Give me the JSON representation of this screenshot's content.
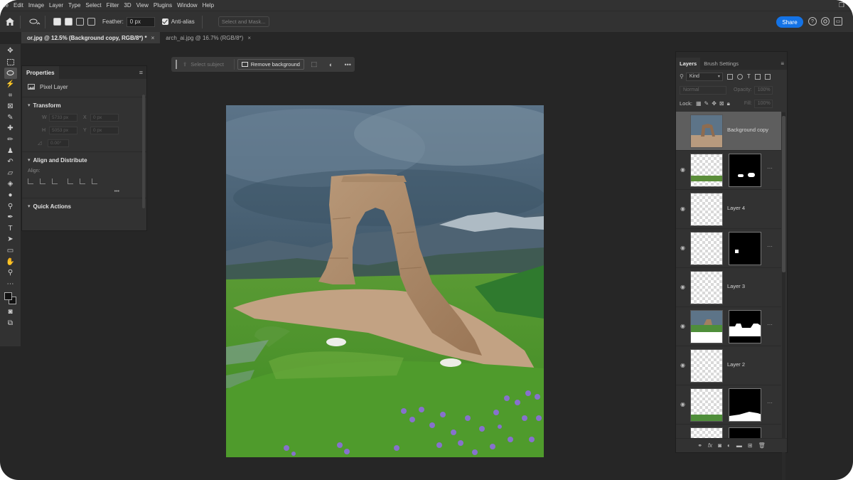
{
  "menu": [
    "ile",
    "Edit",
    "Image",
    "Layer",
    "Type",
    "Select",
    "Filter",
    "3D",
    "View",
    "Plugins",
    "Window",
    "Help"
  ],
  "options": {
    "feather_label": "Feather:",
    "feather_value": "0 px",
    "antialias_label": "Anti-alias",
    "select_mask": "Select and Mask...",
    "share": "Share"
  },
  "tabs": [
    {
      "label": "or.jpg @ 12.5% (Background copy, RGB/8*) *",
      "close": "×"
    },
    {
      "label": "arch_ai.jpg @ 16.7% (RGB/8*)",
      "close": "×"
    }
  ],
  "properties": {
    "title": "Properties",
    "kind": "Pixel Layer",
    "transform": "Transform",
    "w_label": "W",
    "w_value": "5733 px",
    "x_label": "X",
    "x_value": "0 px",
    "h_label": "H",
    "h_value": "5053 px",
    "y_label": "Y",
    "y_value": "0 px",
    "angle_value": "0.00°",
    "align_section": "Align and Distribute",
    "align_label": "Align:",
    "more": "•••",
    "quick_actions": "Quick Actions"
  },
  "context_bar": {
    "select_subject": "Select subject",
    "remove_background": "Remove background",
    "more": "•••"
  },
  "layers_panel": {
    "tab_layers": "Layers",
    "tab_brush": "Brush Settings",
    "kind": "Kind",
    "blend": "Normal",
    "opacity_label": "Opacity:",
    "opacity_value": "100%",
    "lock_label": "Lock:",
    "fill_label": "Fill:",
    "fill_value": "100%",
    "layers": [
      {
        "name": "Background copy",
        "selected": true
      },
      {
        "name": "",
        "selected": false
      },
      {
        "name": "Layer 4",
        "selected": false
      },
      {
        "name": "",
        "selected": false
      },
      {
        "name": "Layer 3",
        "selected": false
      },
      {
        "name": "",
        "selected": false
      },
      {
        "name": "Layer 2",
        "selected": false
      },
      {
        "name": "",
        "selected": false
      }
    ]
  },
  "colors": {
    "accent": "#1473e6",
    "panel": "#323232",
    "app_bg": "#262626"
  }
}
